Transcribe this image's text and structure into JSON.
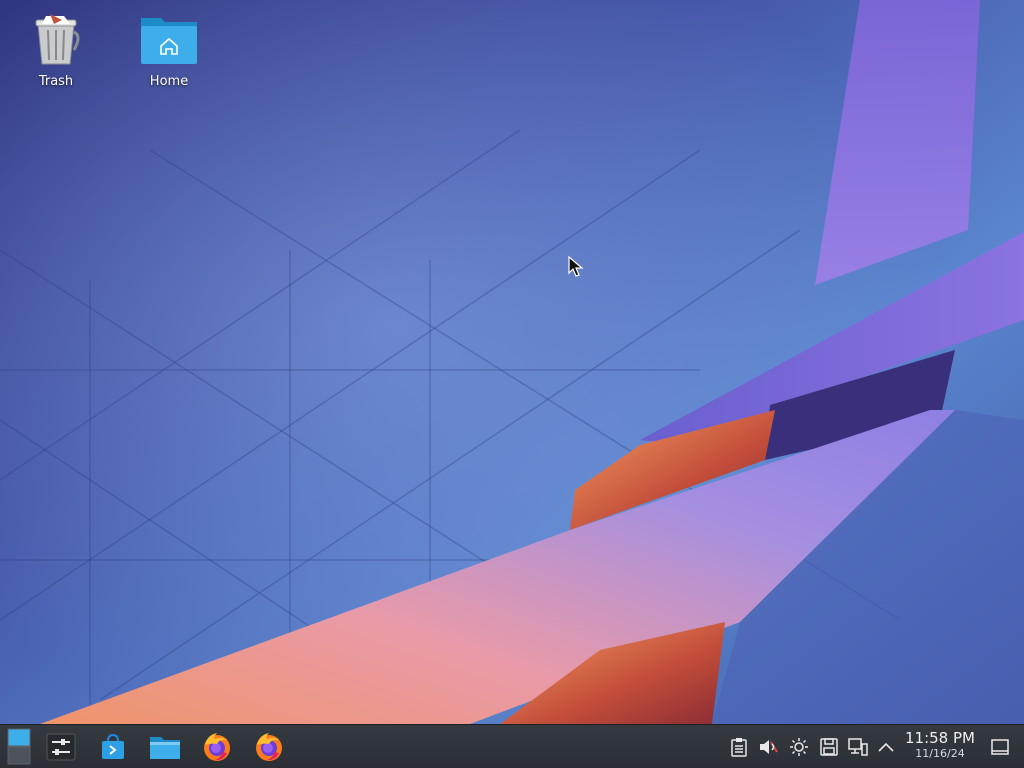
{
  "desktop": {
    "icons": [
      {
        "label": "Trash",
        "icon": "trash-icon"
      },
      {
        "label": "Home",
        "icon": "home-folder-icon"
      }
    ]
  },
  "taskbar": {
    "launchers": [
      {
        "name": "Virtual desktop pager",
        "icon": "pager-icon"
      },
      {
        "name": "System Settings",
        "icon": "settings-sliders-icon"
      },
      {
        "name": "Discover",
        "icon": "store-bag-icon"
      },
      {
        "name": "Dolphin",
        "icon": "folder-icon"
      },
      {
        "name": "Firefox",
        "icon": "firefox-icon"
      },
      {
        "name": "Firefox",
        "icon": "firefox-icon"
      }
    ],
    "tray": [
      {
        "name": "Clipboard",
        "icon": "clipboard-icon"
      },
      {
        "name": "Audio Volume",
        "icon": "speaker-muted-icon"
      },
      {
        "name": "Brightness",
        "icon": "brightness-icon"
      },
      {
        "name": "Disks & Devices",
        "icon": "save-disk-icon"
      },
      {
        "name": "Network",
        "icon": "network-monitor-icon"
      },
      {
        "name": "Show hidden icons",
        "icon": "chevron-up-icon"
      }
    ],
    "clock": {
      "time": "11:58 PM",
      "date": "11/16/24"
    },
    "show_desktop": {
      "icon": "show-desktop-icon"
    }
  },
  "colors": {
    "taskbar_bg": "#2f343a",
    "accent": "#3daee9",
    "wallpaper_base": "#4a5bb5"
  }
}
